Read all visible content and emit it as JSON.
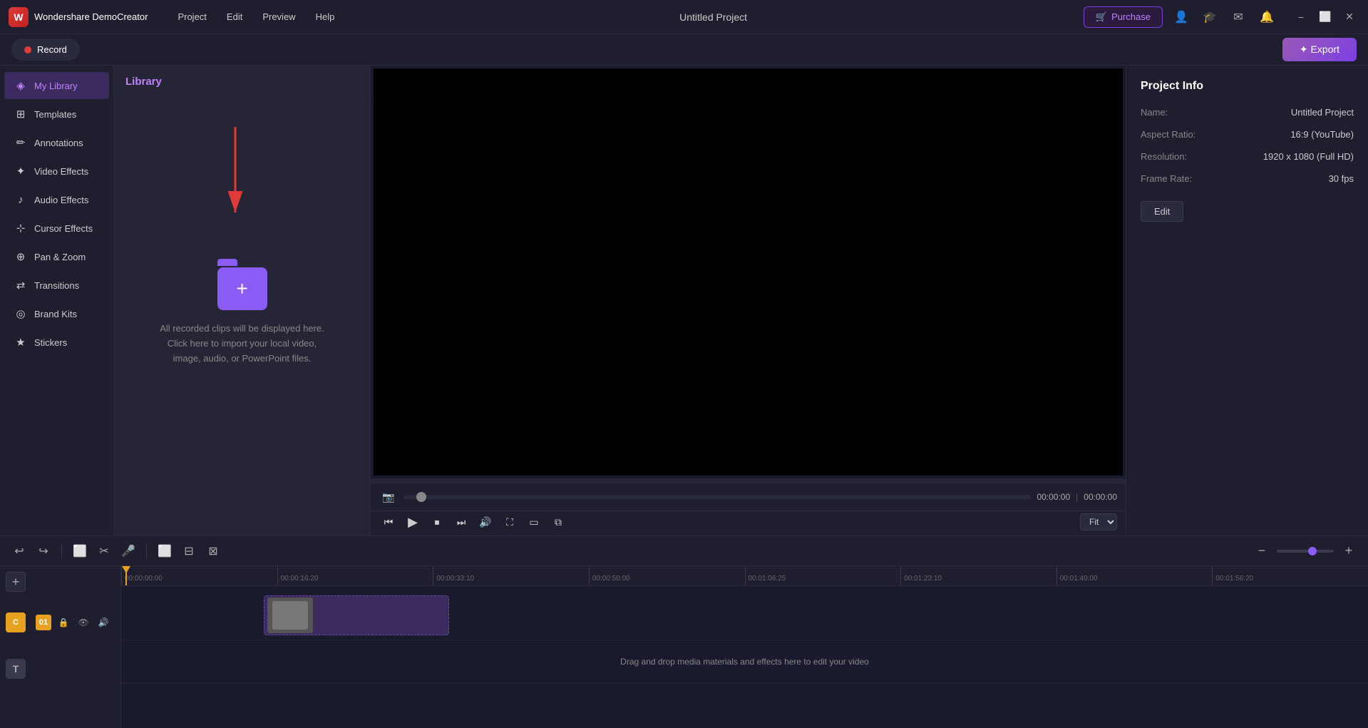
{
  "app": {
    "name": "Wondershare DemoCreator",
    "logo_letter": "W"
  },
  "nav": {
    "items": [
      "Project",
      "Edit",
      "Preview",
      "Help"
    ]
  },
  "project": {
    "title": "Untitled Project"
  },
  "top_right": {
    "purchase_label": "Purchase",
    "export_label": "✦ Export"
  },
  "toolbar_secondary": {
    "record_label": "Record"
  },
  "sidebar": {
    "items": [
      {
        "id": "my-library",
        "label": "My Library",
        "icon": "◈",
        "active": true
      },
      {
        "id": "templates",
        "label": "Templates",
        "icon": "⊞"
      },
      {
        "id": "annotations",
        "label": "Annotations",
        "icon": "✏"
      },
      {
        "id": "video-effects",
        "label": "Video Effects",
        "icon": "✦"
      },
      {
        "id": "audio-effects",
        "label": "Audio Effects",
        "icon": "♪"
      },
      {
        "id": "cursor-effects",
        "label": "Cursor Effects",
        "icon": "⊹"
      },
      {
        "id": "pan-zoom",
        "label": "Pan & Zoom",
        "icon": "⊕"
      },
      {
        "id": "transitions",
        "label": "Transitions",
        "icon": "⇄"
      },
      {
        "id": "brand-kits",
        "label": "Brand Kits",
        "icon": "◎"
      },
      {
        "id": "stickers",
        "label": "Stickers",
        "icon": "★"
      }
    ]
  },
  "library": {
    "header": "Library",
    "hint_line1": "All recorded clips will be displayed here.",
    "hint_line2": "Click here to import your local video,",
    "hint_line3": "image, audio, or PowerPoint files."
  },
  "project_info": {
    "panel_title": "Project Info",
    "name_label": "Name:",
    "name_value": "Untitled Project",
    "aspect_ratio_label": "Aspect Ratio:",
    "aspect_ratio_value": "16:9 (YouTube)",
    "resolution_label": "Resolution:",
    "resolution_value": "1920 x 1080 (Full HD)",
    "frame_rate_label": "Frame Rate:",
    "frame_rate_value": "30 fps",
    "edit_button": "Edit"
  },
  "video_controls": {
    "current_time": "00:00:00",
    "total_time": "00:00:00",
    "fit_label": "Fit"
  },
  "timeline": {
    "ruler_marks": [
      "00:00:00:00",
      "00:00:16:20",
      "00:00:33:10",
      "00:00:50:00",
      "00:01:06:25",
      "00:01:23:10",
      "00:01:40:00",
      "00:01:56:20"
    ],
    "drag_hint": "Drag and drop media materials and effects here to edit your video",
    "track_number": "01"
  }
}
